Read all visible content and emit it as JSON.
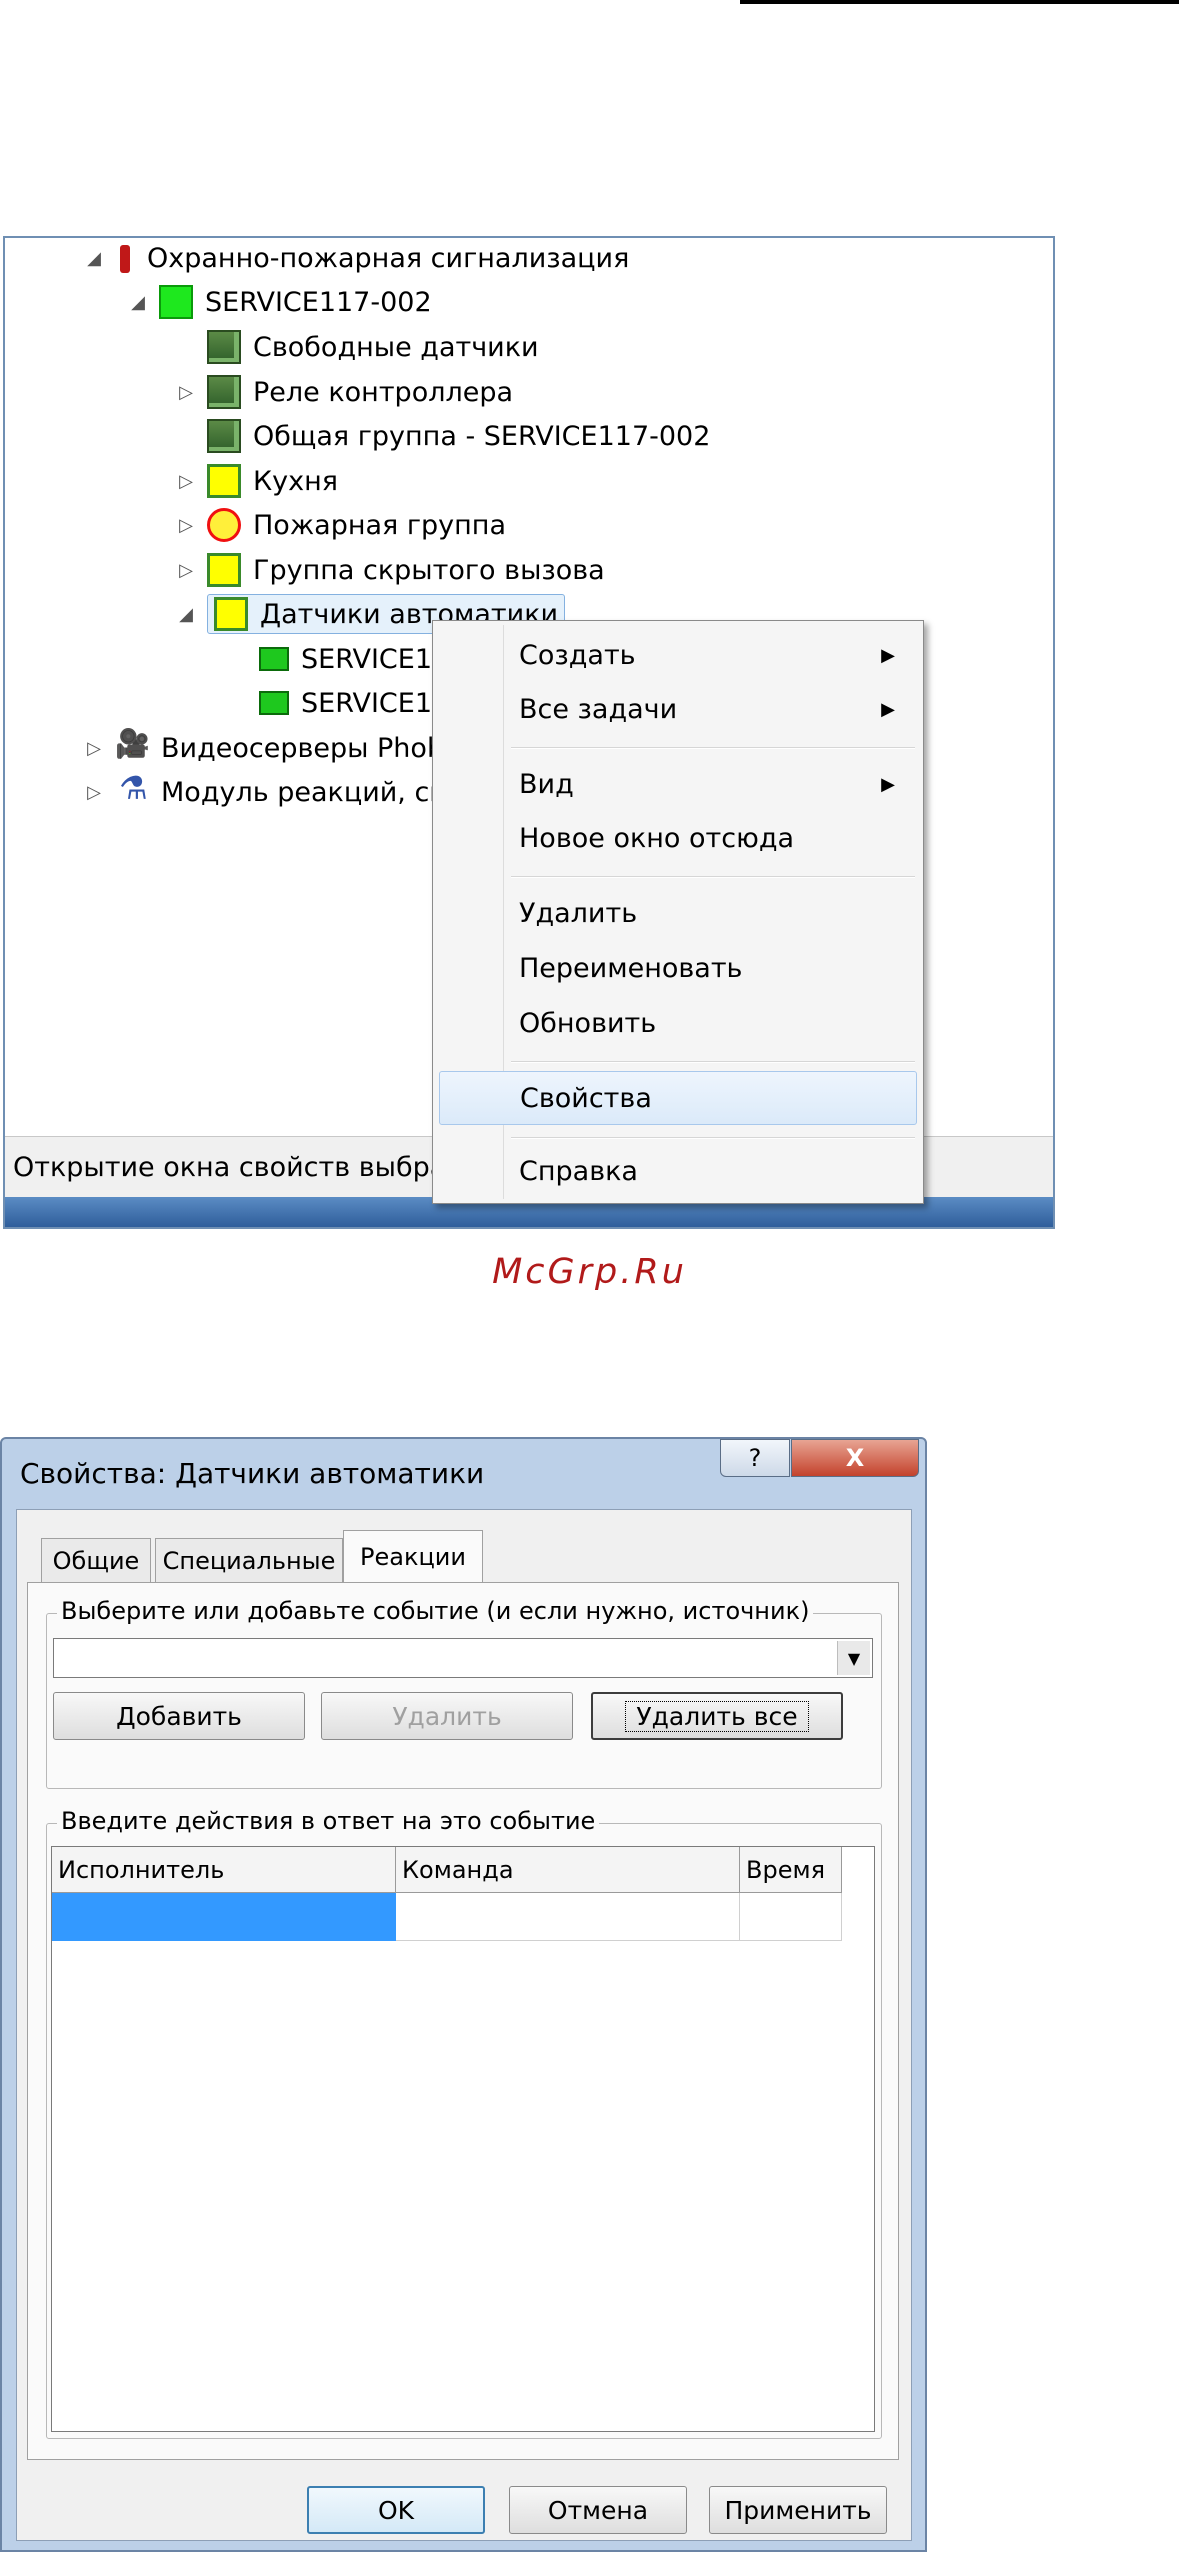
{
  "tree": {
    "nodes": [
      {
        "label": "Охранно-пожарная сигнализация",
        "icon": "extinguisher-icon",
        "toggle": "◢"
      },
      {
        "label": "SERVICE117-002",
        "icon": "controller-green-icon",
        "toggle": "◢"
      },
      {
        "label": "Свободные датчики",
        "icon": "group-folder-icon",
        "toggle": ""
      },
      {
        "label": "Реле контроллера",
        "icon": "group-folder-icon",
        "toggle": "▷"
      },
      {
        "label": "Общая группа - SERVICE117-002",
        "icon": "group-folder-icon",
        "toggle": ""
      },
      {
        "label": "Кухня",
        "icon": "yellow-group-icon",
        "toggle": "▷"
      },
      {
        "label": "Пожарная группа",
        "icon": "fire-group-icon",
        "toggle": "▷"
      },
      {
        "label": "Группа скрытого вызова",
        "icon": "yellow-group-icon",
        "toggle": "▷"
      },
      {
        "label": "Датчики автоматики",
        "icon": "yellow-group-icon",
        "toggle": "◢"
      },
      {
        "label": "SERVICE11",
        "icon": "relay-sensor-icon",
        "toggle": ""
      },
      {
        "label": "SERVICE11",
        "icon": "circle-sensor-icon",
        "toggle": ""
      },
      {
        "label": "Видеосерверы Phob",
        "icon": "camera-icon",
        "toggle": "▷"
      },
      {
        "label": "Модуль реакций, ск",
        "icon": "flask-icon",
        "toggle": "▷"
      }
    ],
    "status_text": "Открытие окна свойств выбран"
  },
  "context_menu": {
    "items": [
      {
        "label": "Создать",
        "submenu": "▶"
      },
      {
        "label": "Все задачи",
        "submenu": "▶"
      },
      {
        "label": "Вид",
        "submenu": "▶"
      },
      {
        "label": "Новое окно отсюда"
      },
      {
        "label": "Удалить"
      },
      {
        "label": "Переименовать"
      },
      {
        "label": "Обновить"
      },
      {
        "label": "Свойства"
      },
      {
        "label": "Справка"
      }
    ]
  },
  "watermark": "McGrp.Ru",
  "dialog": {
    "title": "Свойства: Датчики автоматики",
    "help_glyph": "?",
    "close_glyph": "X",
    "tabs": [
      "Общие",
      "Специальные",
      "Реакции"
    ],
    "active_tab": "Реакции",
    "event_group_label": "Выберите или добавьте событие (и если нужно, источник)",
    "event_combo_value": "",
    "combo_arrow": "▼",
    "buttons": {
      "add": "Добавить",
      "delete": "Удалить",
      "delete_all": "Удалить все"
    },
    "actions_group_label": "Введите действия в ответ на это событие",
    "columns": [
      "Исполнитель",
      "Команда",
      "Время"
    ],
    "footer": {
      "ok": "OK",
      "cancel": "Отмена",
      "apply": "Применить"
    }
  },
  "colors": {
    "selection": "#3399ff",
    "menu_highlight": "#dbeaf9",
    "watermark": "#b11a1a",
    "close_button": "#c3422c"
  }
}
